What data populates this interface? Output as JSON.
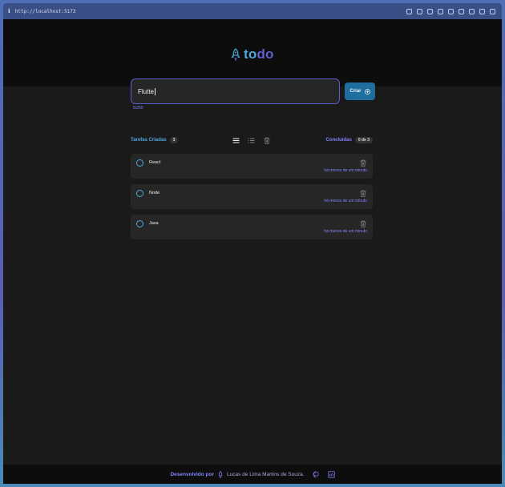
{
  "browser": {
    "url": "http://localhost:5173"
  },
  "header": {
    "logo_part1": "to",
    "logo_part2": "do"
  },
  "form": {
    "input_value": "Flutte",
    "create_label": "Criar",
    "char_counter": "6/250"
  },
  "stats": {
    "created_label": "Tarefas Criadas",
    "created_count": "3",
    "done_label": "Concluídas",
    "done_count": "0 de 3"
  },
  "tasks": [
    {
      "name": "React",
      "time": "há menos de um minuto"
    },
    {
      "name": "Node",
      "time": "há menos de um minuto"
    },
    {
      "name": "Java",
      "time": "há menos de um minuto"
    }
  ],
  "footer": {
    "developed_by": "Desenvolvido por",
    "author": "Lucas de Lima Martins de Souza."
  },
  "icons": {
    "logo": "rocket-icon",
    "create": "plus-circle-icon",
    "view_list": "list-icon",
    "view_checklist": "checklist-icon",
    "clear": "trash-icon",
    "github": "github-icon",
    "linkedin": "linkedin-icon"
  },
  "colors": {
    "blue": "#4ea8de",
    "purple": "#5e60ce",
    "purple_light": "#8284fa",
    "button": "#1e6f9f"
  }
}
